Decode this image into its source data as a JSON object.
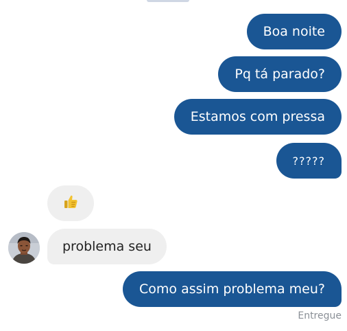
{
  "conversation": {
    "messages": [
      {
        "direction": "outgoing",
        "text": "Boa noite"
      },
      {
        "direction": "outgoing",
        "text": "Pq tá parado?"
      },
      {
        "direction": "outgoing",
        "text": "Estamos com pressa"
      },
      {
        "direction": "outgoing",
        "text": "?????"
      },
      {
        "direction": "incoming",
        "text": "👍"
      },
      {
        "direction": "incoming",
        "text": "problema seu"
      },
      {
        "direction": "outgoing",
        "text": "Como assim problema meu?"
      }
    ],
    "status": "Entregue"
  },
  "colors": {
    "outgoing_bubble": "#1a5694",
    "incoming_bubble": "#efefef",
    "status_text": "#8a8f96"
  },
  "icons": {
    "thumbs_up": "thumbs-up-emoji",
    "contact_avatar": "contact-avatar-photo"
  }
}
